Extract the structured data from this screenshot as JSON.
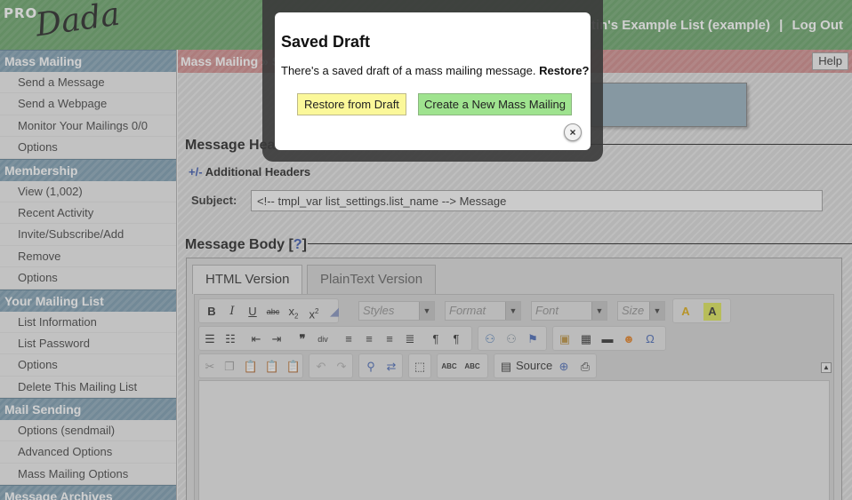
{
  "header": {
    "logo_pro": "PRO",
    "logo_dada": "Dada",
    "list_name": "Justin's Example List (example)",
    "separator": "|",
    "logout": "Log Out"
  },
  "sidebar": {
    "sections": [
      {
        "title": "Mass Mailing",
        "items": [
          "Send a Message",
          "Send a Webpage",
          "Monitor Your Mailings 0/0",
          "Options"
        ]
      },
      {
        "title": "Membership",
        "items": [
          "View (1,002)",
          "Recent Activity",
          "Invite/Subscribe/Add",
          "Remove",
          "Options"
        ]
      },
      {
        "title": "Your Mailing List",
        "items": [
          "List Information",
          "List Password",
          "Options",
          "Delete This Mailing List"
        ]
      },
      {
        "title": "Mail Sending",
        "items": [
          "Options (sendmail)",
          "Advanced Options",
          "Mass Mailing Options"
        ]
      },
      {
        "title": "Message Archives",
        "items": []
      }
    ]
  },
  "main": {
    "breadcrumb": "Mass Mailing » Se",
    "help": "Help",
    "headers_title": "Message Hea",
    "toggle": "+/-",
    "additional_headers": "Additional Headers",
    "subject_label": "Subject:",
    "subject_value": "<!-- tmpl_var list_settings.list_name --> Message",
    "body_title": "Message Body",
    "body_help_open": "[",
    "body_help_q": "?",
    "body_help_close": "]",
    "tabs": [
      "HTML Version",
      "PlainText Version"
    ],
    "toolbar": {
      "styles": "Styles",
      "format": "Format",
      "font": "Font",
      "size": "Size",
      "source": "Source"
    }
  },
  "modal": {
    "title": "Saved Draft",
    "message": "There's a saved draft of a mass mailing message.",
    "message_bold": "Restore?",
    "restore_button": "Restore from Draft",
    "create_button": "Create a New Mass Mailing",
    "close": "×"
  }
}
